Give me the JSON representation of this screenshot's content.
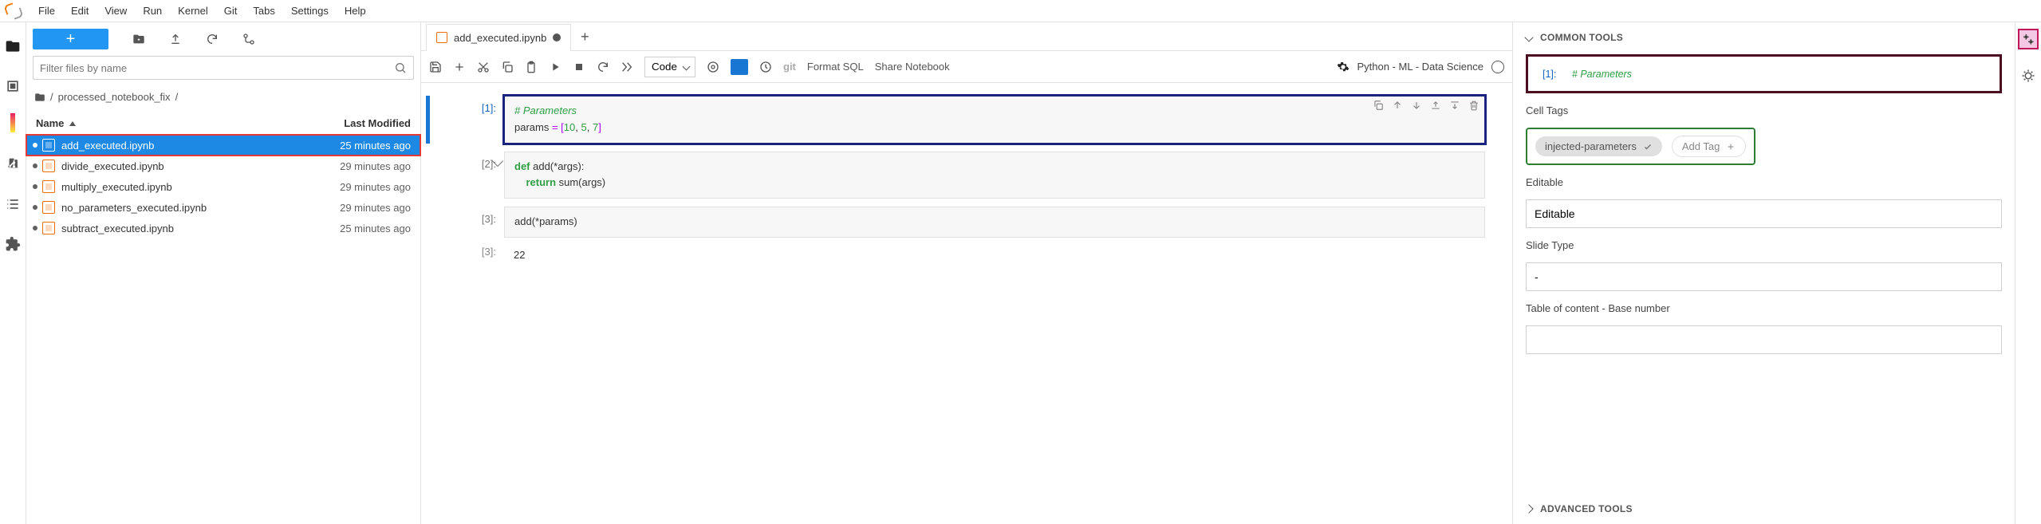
{
  "menu": [
    "File",
    "Edit",
    "View",
    "Run",
    "Kernel",
    "Git",
    "Tabs",
    "Settings",
    "Help"
  ],
  "files": {
    "filter_placeholder": "Filter files by name",
    "breadcrumb_folder": "processed_notebook_fix",
    "columns": {
      "name": "Name",
      "modified": "Last Modified"
    },
    "rows": [
      {
        "name": "add_executed.ipynb",
        "modified": "25 minutes ago",
        "selected": true
      },
      {
        "name": "divide_executed.ipynb",
        "modified": "29 minutes ago",
        "selected": false
      },
      {
        "name": "multiply_executed.ipynb",
        "modified": "29 minutes ago",
        "selected": false
      },
      {
        "name": "no_parameters_executed.ipynb",
        "modified": "29 minutes ago",
        "selected": false
      },
      {
        "name": "subtract_executed.ipynb",
        "modified": "25 minutes ago",
        "selected": false
      }
    ]
  },
  "tab": {
    "title": "add_executed.ipynb"
  },
  "nb_toolbar": {
    "cell_type": "Code",
    "format_sql": "Format SQL",
    "share": "Share Notebook",
    "kernel": "Python - ML - Data Science"
  },
  "cells": {
    "c1": {
      "prompt": "[1]:",
      "line1": "# Parameters",
      "line2a": "params",
      "line2b": " = [",
      "line2c": "10",
      "line2d": ", ",
      "line2e": "5",
      "line2f": ", ",
      "line2g": "7",
      "line2h": "]"
    },
    "c2": {
      "prompt": "[2]:",
      "line1a": "def",
      "line1b": " add(*args):",
      "line2a": "    return",
      "line2b": " sum(args)"
    },
    "c3": {
      "prompt": "[3]:",
      "code": "add(*params)"
    },
    "out3": {
      "prompt": "[3]:",
      "value": "22"
    }
  },
  "right": {
    "common_tools": "COMMON TOOLS",
    "preview_prompt": "[1]:",
    "preview_text": "# Parameters",
    "cell_tags_label": "Cell Tags",
    "tag": "injected-parameters",
    "add_tag": "Add Tag",
    "editable_label": "Editable",
    "editable_value": "Editable",
    "slide_label": "Slide Type",
    "slide_value": "-",
    "toc_label": "Table of content - Base number",
    "toc_value": "",
    "advanced": "ADVANCED TOOLS"
  }
}
